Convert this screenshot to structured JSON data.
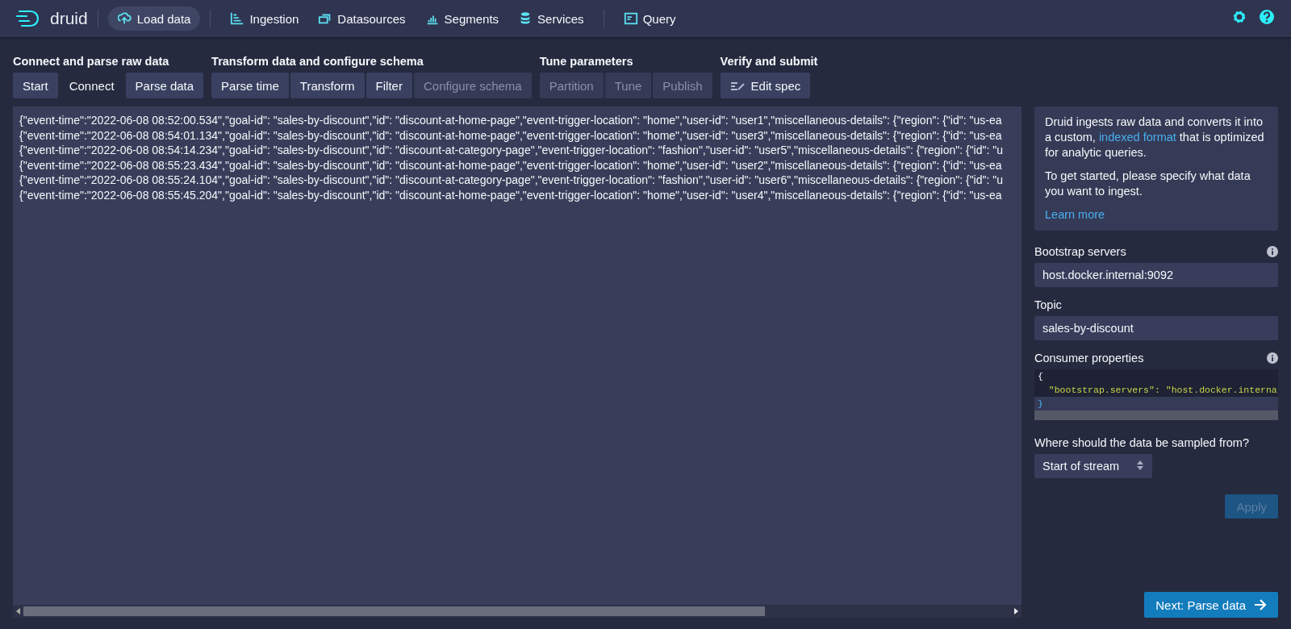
{
  "header": {
    "logo": "druid",
    "nav": [
      {
        "label": "Load data",
        "selected": true
      },
      {
        "label": "Ingestion",
        "selected": false
      },
      {
        "label": "Datasources",
        "selected": false
      },
      {
        "label": "Segments",
        "selected": false
      },
      {
        "label": "Services",
        "selected": false
      },
      {
        "label": "Query",
        "selected": false
      }
    ]
  },
  "step_groups": [
    {
      "title": "Connect and parse raw data",
      "steps": [
        {
          "label": "Start",
          "selected": false,
          "disabled": false
        },
        {
          "label": "Connect",
          "selected": true,
          "disabled": false
        },
        {
          "label": "Parse data",
          "selected": false,
          "disabled": false
        }
      ]
    },
    {
      "title": "Transform data and configure schema",
      "steps": [
        {
          "label": "Parse time",
          "selected": false,
          "disabled": false
        },
        {
          "label": "Transform",
          "selected": false,
          "disabled": false
        },
        {
          "label": "Filter",
          "selected": false,
          "disabled": false
        },
        {
          "label": "Configure schema",
          "selected": false,
          "disabled": true
        }
      ]
    },
    {
      "title": "Tune parameters",
      "steps": [
        {
          "label": "Partition",
          "selected": false,
          "disabled": true
        },
        {
          "label": "Tune",
          "selected": false,
          "disabled": true
        },
        {
          "label": "Publish",
          "selected": false,
          "disabled": true
        }
      ]
    },
    {
      "title": "Verify and submit",
      "steps": [
        {
          "label": "Edit spec",
          "selected": false,
          "disabled": false
        }
      ]
    }
  ],
  "raw_data": [
    "{\"event-time\":\"2022-06-08 08:52:00.534\",\"goal-id\": \"sales-by-discount\",\"id\": \"discount-at-home-page\",\"event-trigger-location\": \"home\",\"user-id\": \"user1\",\"miscellaneous-details\": {\"region\": {\"id\": \"us-ea",
    "{\"event-time\":\"2022-06-08 08:54:01.134\",\"goal-id\": \"sales-by-discount\",\"id\": \"discount-at-home-page\",\"event-trigger-location\": \"home\",\"user-id\": \"user3\",\"miscellaneous-details\": {\"region\": {\"id\": \"us-ea",
    "{\"event-time\":\"2022-06-08 08:54:14.234\",\"goal-id\": \"sales-by-discount\",\"id\": \"discount-at-category-page\",\"event-trigger-location\": \"fashion\",\"user-id\": \"user5\",\"miscellaneous-details\": {\"region\": {\"id\": \"u",
    "{\"event-time\":\"2022-06-08 08:55:23.434\",\"goal-id\": \"sales-by-discount\",\"id\": \"discount-at-home-page\",\"event-trigger-location\": \"home\",\"user-id\": \"user2\",\"miscellaneous-details\": {\"region\": {\"id\": \"us-ea",
    "{\"event-time\":\"2022-06-08 08:55:24.104\",\"goal-id\": \"sales-by-discount\",\"id\": \"discount-at-category-page\",\"event-trigger-location\": \"fashion\",\"user-id\": \"user6\",\"miscellaneous-details\": {\"region\": {\"id\": \"u",
    "{\"event-time\":\"2022-06-08 08:55:45.204\",\"goal-id\": \"sales-by-discount\",\"id\": \"discount-at-home-page\",\"event-trigger-location\": \"home\",\"user-id\": \"user4\",\"miscellaneous-details\": {\"region\": {\"id\": \"us-ea"
  ],
  "side": {
    "intro": [
      {
        "text": "Druid ingests raw data and converts it into a custom, ",
        "link": "indexed format",
        "after": " that is optimized for analytic queries."
      },
      {
        "text": "To get started, please specify what data you want to ingest."
      }
    ],
    "learn_more": "Learn more",
    "fields": [
      {
        "kind": "input",
        "label": "Bootstrap servers",
        "info": true,
        "value": "host.docker.internal:9092"
      },
      {
        "kind": "input",
        "label": "Topic",
        "info": false,
        "value": "sales-by-discount"
      },
      {
        "kind": "code",
        "label": "Consumer properties",
        "info": true,
        "lines": [
          "{",
          "  \"bootstrap.servers\": \"host.docker.interna",
          "}"
        ]
      },
      {
        "kind": "select",
        "label": "Where should the data be sampled from?",
        "info": false,
        "value": "Start of stream"
      }
    ],
    "apply": {
      "label": "Apply",
      "disabled": true
    },
    "next": {
      "label": "Next: Parse data"
    }
  }
}
